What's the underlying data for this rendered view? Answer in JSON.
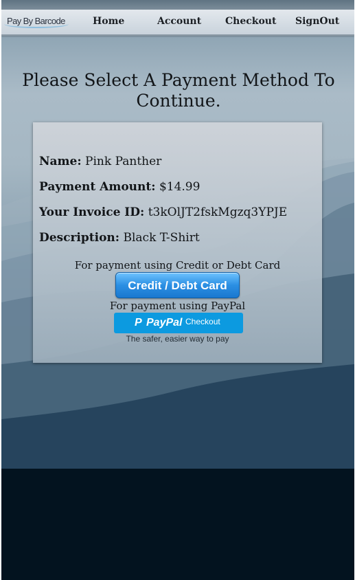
{
  "nav": {
    "logo": "Pay By Barcode",
    "items": [
      "Home",
      "Account",
      "Checkout",
      "SignOut"
    ]
  },
  "page_title": "Please Select A Payment Method To Continue.",
  "details": {
    "name_label": "Name:",
    "name_value": "Pink Panther",
    "amount_label": "Payment Amount:",
    "amount_value": "$14.99",
    "invoice_label": "Your Invoice ID:",
    "invoice_value": "t3kOlJT2fskMgzq3YPJE",
    "description_label": "Description:",
    "description_value": "Black T-Shirt"
  },
  "payment": {
    "card_caption": "For payment using Credit or Debt Card",
    "card_button": "Credit / Debt Card",
    "paypal_caption": "For payment using PayPal",
    "paypal_logo_p": "P",
    "paypal_logo_word": "PayPal",
    "paypal_checkout": "Checkout",
    "paypal_tagline": "The safer, easier way to pay"
  },
  "colors": {
    "button_blue": "#2b8fe3",
    "paypal_blue": "#0c9ae0",
    "footer_dark": "#03131f"
  }
}
